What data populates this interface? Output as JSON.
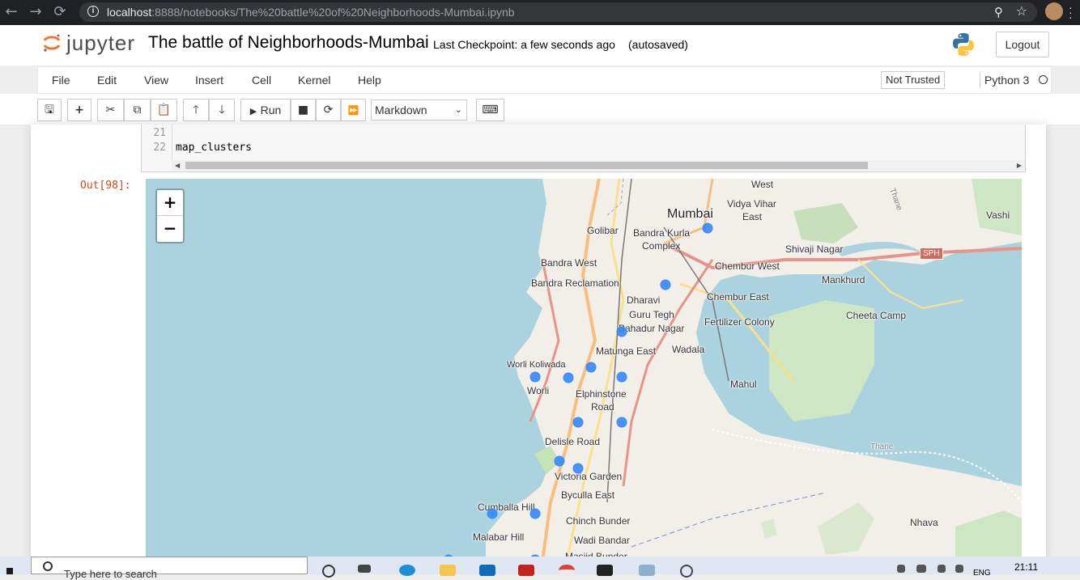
{
  "browser": {
    "url_host": "localhost",
    "url_rest": ":8888/notebooks/The%20battle%20of%20Neighborhoods-Mumbai.ipynb"
  },
  "header": {
    "logo_text": "jupyter",
    "notebook_title": "The battle of Neighborhoods-Mumbai",
    "checkpoint": "Last Checkpoint: a few seconds ago",
    "autosaved": "(autosaved)",
    "logout_label": "Logout"
  },
  "menubar": {
    "items": [
      {
        "label": "File"
      },
      {
        "label": "Edit"
      },
      {
        "label": "View"
      },
      {
        "label": "Insert"
      },
      {
        "label": "Cell"
      },
      {
        "label": "Kernel"
      },
      {
        "label": "Help"
      }
    ],
    "trust_status": "Not Trusted",
    "kernel_name": "Python 3"
  },
  "toolbar": {
    "run_label": "Run",
    "cell_type": "Markdown"
  },
  "cell": {
    "line_numbers": [
      "21",
      "22"
    ],
    "code": "map_clusters",
    "out_prompt": "Out[98]:"
  },
  "map": {
    "zoom_in": "+",
    "zoom_out": "−",
    "labels": {
      "west": "West",
      "vidya_vihar": "Vidya Vihar",
      "vidya_vihar_east": "East",
      "thane1": "Thane",
      "vashi": "Vashi",
      "mumbai": "Mumbai",
      "golibar": "Golibar",
      "bandra_kurla": "Bandra Kurla",
      "complex": "Complex",
      "shivaji_nagar": "Shivaji Nagar",
      "sph": "SPH",
      "bandra_west": "Bandra West",
      "chembur_west": "Chembur West",
      "mankhurd": "Mankhurd",
      "bandra_reclamation": "Bandra Reclamation",
      "dharavi": "Dharavi",
      "chembur_east": "Chembur East",
      "guru_tegh": "Guru Tegh",
      "cheeta_camp": "Cheeta Camp",
      "bahadur_nagar": "Bahadur Nagar",
      "fertilizer_colony": "Fertilizer Colony",
      "matunga_east": "Matunga East",
      "wadala": "Wadala",
      "worli_koliwada": "Worli Koliwada",
      "mahul": "Mahul",
      "worli": "Worli",
      "elphinstone": "Elphinstone",
      "road": "Road",
      "delisle_road": "Delisle Road",
      "thane2": "Thane",
      "victoria_garden": "Victoria Garden",
      "byculla_east": "Byculla East",
      "cumballa_hill": "Cumballa Hill",
      "chinch_bunder": "Chinch Bunder",
      "nhava": "Nhava",
      "malabar_hill": "Malabar Hill",
      "wadi_bandar": "Wadi Bandar",
      "masjid_bunder": "Masjid Bunder"
    },
    "marker_color": "#3388ff"
  },
  "taskbar": {
    "search_placeholder": "Type here to search",
    "lang": "ENG",
    "time": "21:11"
  }
}
